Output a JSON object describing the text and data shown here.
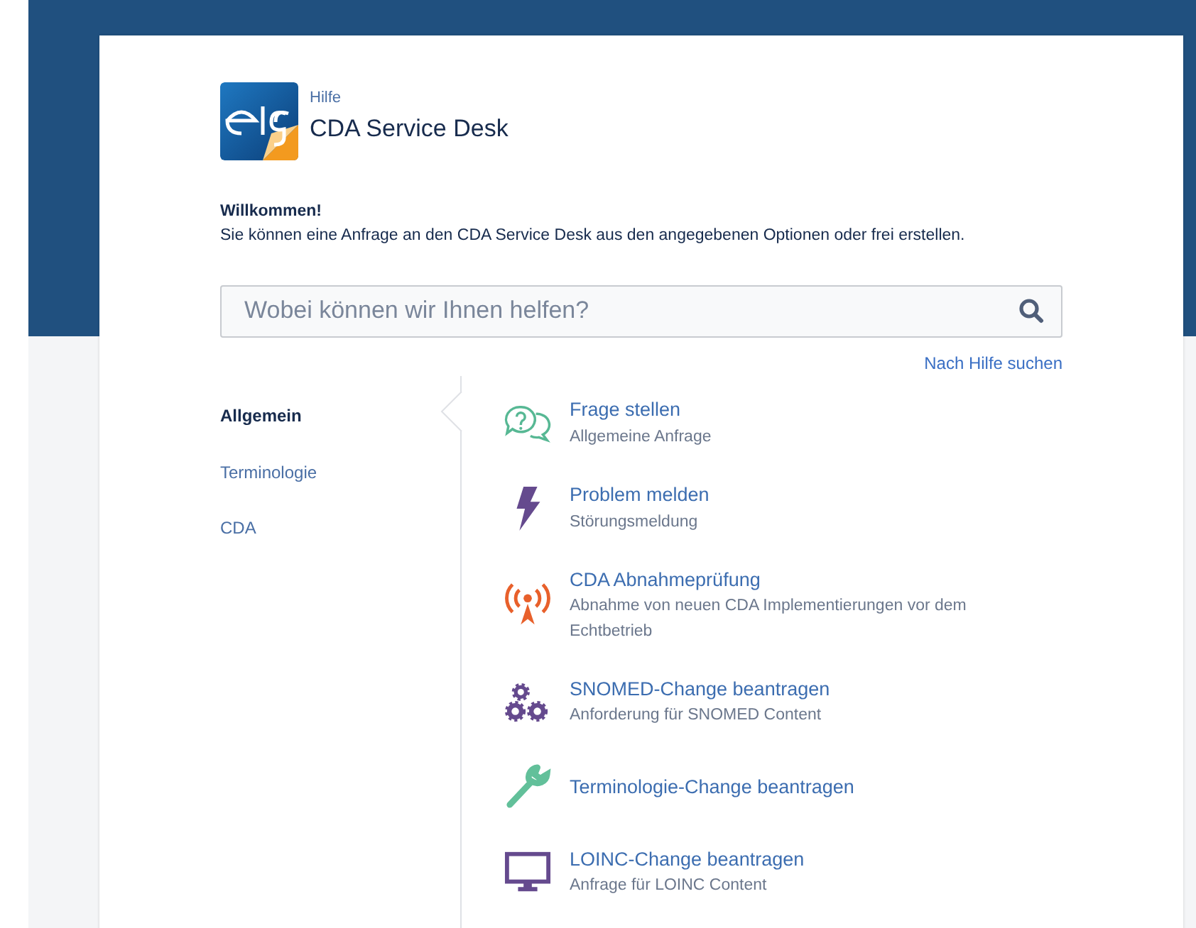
{
  "header": {
    "breadcrumb": "Hilfe",
    "title": "CDA Service Desk"
  },
  "welcome": {
    "heading": "Willkommen!",
    "text": "Sie können eine Anfrage an den CDA Service Desk aus den angegebenen Optionen oder frei erstellen."
  },
  "search": {
    "placeholder": "Wobei können wir Ihnen helfen?",
    "link": "Nach Hilfe suchen"
  },
  "categories": [
    {
      "label": "Allgemein",
      "selected": true
    },
    {
      "label": "Terminologie",
      "selected": false
    },
    {
      "label": "CDA",
      "selected": false
    }
  ],
  "request_types": [
    {
      "kind": "chat",
      "title": "Frage stellen",
      "description": "Allgemeine Anfrage"
    },
    {
      "kind": "bolt",
      "title": "Problem melden",
      "description": "Störungsmeldung"
    },
    {
      "kind": "antenna",
      "title": "CDA Abnahmeprüfung",
      "description": "Abnahme von neuen CDA Implementierungen vor dem Echtbetrieb"
    },
    {
      "kind": "gears",
      "title": "SNOMED-Change beantragen",
      "description": "Anforderung für SNOMED Content"
    },
    {
      "kind": "wrench",
      "title": "Terminologie-Change beantragen"
    },
    {
      "kind": "monitor",
      "title": "LOINC-Change beantragen",
      "description": "Anfrage für LOINC Content"
    }
  ]
}
